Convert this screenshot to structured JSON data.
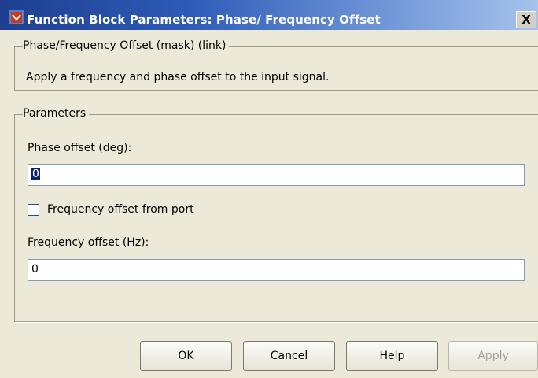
{
  "window": {
    "title": "Function Block Parameters: Phase/ Frequency Offset",
    "close_label": "X"
  },
  "mask": {
    "legend": "Phase/Frequency Offset (mask) (link)",
    "description": "Apply a frequency and phase offset to the input signal."
  },
  "parameters": {
    "legend": "Parameters",
    "phase_offset_label": "Phase offset (deg):",
    "phase_offset_value": "0",
    "freq_port_label": "Frequency offset from port",
    "freq_port_checked": false,
    "freq_offset_label": "Frequency offset (Hz):",
    "freq_offset_value": "0"
  },
  "buttons": {
    "ok": "OK",
    "cancel": "Cancel",
    "help": "Help",
    "apply": "Apply"
  },
  "icons": {
    "window_icon": "simulink-block-icon"
  }
}
